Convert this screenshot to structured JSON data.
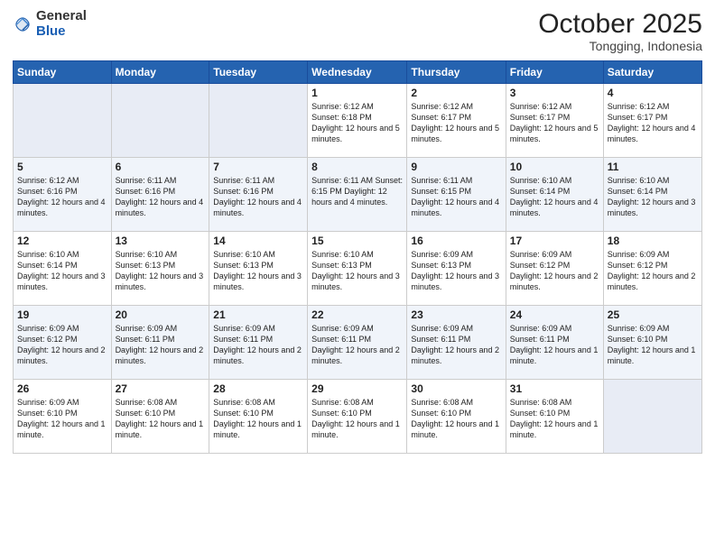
{
  "logo": {
    "general": "General",
    "blue": "Blue"
  },
  "header": {
    "month": "October 2025",
    "location": "Tongging, Indonesia"
  },
  "weekdays": [
    "Sunday",
    "Monday",
    "Tuesday",
    "Wednesday",
    "Thursday",
    "Friday",
    "Saturday"
  ],
  "weeks": [
    [
      {
        "day": "",
        "info": ""
      },
      {
        "day": "",
        "info": ""
      },
      {
        "day": "",
        "info": ""
      },
      {
        "day": "1",
        "info": "Sunrise: 6:12 AM\nSunset: 6:18 PM\nDaylight: 12 hours\nand 5 minutes."
      },
      {
        "day": "2",
        "info": "Sunrise: 6:12 AM\nSunset: 6:17 PM\nDaylight: 12 hours\nand 5 minutes."
      },
      {
        "day": "3",
        "info": "Sunrise: 6:12 AM\nSunset: 6:17 PM\nDaylight: 12 hours\nand 5 minutes."
      },
      {
        "day": "4",
        "info": "Sunrise: 6:12 AM\nSunset: 6:17 PM\nDaylight: 12 hours\nand 4 minutes."
      }
    ],
    [
      {
        "day": "5",
        "info": "Sunrise: 6:12 AM\nSunset: 6:16 PM\nDaylight: 12 hours\nand 4 minutes."
      },
      {
        "day": "6",
        "info": "Sunrise: 6:11 AM\nSunset: 6:16 PM\nDaylight: 12 hours\nand 4 minutes."
      },
      {
        "day": "7",
        "info": "Sunrise: 6:11 AM\nSunset: 6:16 PM\nDaylight: 12 hours\nand 4 minutes."
      },
      {
        "day": "8",
        "info": "Sunrise: 6:11 AM\nSunset: 6:15 PM\nDaylight: 12 hours\nand 4 minutes."
      },
      {
        "day": "9",
        "info": "Sunrise: 6:11 AM\nSunset: 6:15 PM\nDaylight: 12 hours\nand 4 minutes."
      },
      {
        "day": "10",
        "info": "Sunrise: 6:10 AM\nSunset: 6:14 PM\nDaylight: 12 hours\nand 4 minutes."
      },
      {
        "day": "11",
        "info": "Sunrise: 6:10 AM\nSunset: 6:14 PM\nDaylight: 12 hours\nand 3 minutes."
      }
    ],
    [
      {
        "day": "12",
        "info": "Sunrise: 6:10 AM\nSunset: 6:14 PM\nDaylight: 12 hours\nand 3 minutes."
      },
      {
        "day": "13",
        "info": "Sunrise: 6:10 AM\nSunset: 6:13 PM\nDaylight: 12 hours\nand 3 minutes."
      },
      {
        "day": "14",
        "info": "Sunrise: 6:10 AM\nSunset: 6:13 PM\nDaylight: 12 hours\nand 3 minutes."
      },
      {
        "day": "15",
        "info": "Sunrise: 6:10 AM\nSunset: 6:13 PM\nDaylight: 12 hours\nand 3 minutes."
      },
      {
        "day": "16",
        "info": "Sunrise: 6:09 AM\nSunset: 6:13 PM\nDaylight: 12 hours\nand 3 minutes."
      },
      {
        "day": "17",
        "info": "Sunrise: 6:09 AM\nSunset: 6:12 PM\nDaylight: 12 hours\nand 2 minutes."
      },
      {
        "day": "18",
        "info": "Sunrise: 6:09 AM\nSunset: 6:12 PM\nDaylight: 12 hours\nand 2 minutes."
      }
    ],
    [
      {
        "day": "19",
        "info": "Sunrise: 6:09 AM\nSunset: 6:12 PM\nDaylight: 12 hours\nand 2 minutes."
      },
      {
        "day": "20",
        "info": "Sunrise: 6:09 AM\nSunset: 6:11 PM\nDaylight: 12 hours\nand 2 minutes."
      },
      {
        "day": "21",
        "info": "Sunrise: 6:09 AM\nSunset: 6:11 PM\nDaylight: 12 hours\nand 2 minutes."
      },
      {
        "day": "22",
        "info": "Sunrise: 6:09 AM\nSunset: 6:11 PM\nDaylight: 12 hours\nand 2 minutes."
      },
      {
        "day": "23",
        "info": "Sunrise: 6:09 AM\nSunset: 6:11 PM\nDaylight: 12 hours\nand 2 minutes."
      },
      {
        "day": "24",
        "info": "Sunrise: 6:09 AM\nSunset: 6:11 PM\nDaylight: 12 hours\nand 1 minute."
      },
      {
        "day": "25",
        "info": "Sunrise: 6:09 AM\nSunset: 6:10 PM\nDaylight: 12 hours\nand 1 minute."
      }
    ],
    [
      {
        "day": "26",
        "info": "Sunrise: 6:09 AM\nSunset: 6:10 PM\nDaylight: 12 hours\nand 1 minute."
      },
      {
        "day": "27",
        "info": "Sunrise: 6:08 AM\nSunset: 6:10 PM\nDaylight: 12 hours\nand 1 minute."
      },
      {
        "day": "28",
        "info": "Sunrise: 6:08 AM\nSunset: 6:10 PM\nDaylight: 12 hours\nand 1 minute."
      },
      {
        "day": "29",
        "info": "Sunrise: 6:08 AM\nSunset: 6:10 PM\nDaylight: 12 hours\nand 1 minute."
      },
      {
        "day": "30",
        "info": "Sunrise: 6:08 AM\nSunset: 6:10 PM\nDaylight: 12 hours\nand 1 minute."
      },
      {
        "day": "31",
        "info": "Sunrise: 6:08 AM\nSunset: 6:10 PM\nDaylight: 12 hours\nand 1 minute."
      },
      {
        "day": "",
        "info": ""
      }
    ]
  ]
}
